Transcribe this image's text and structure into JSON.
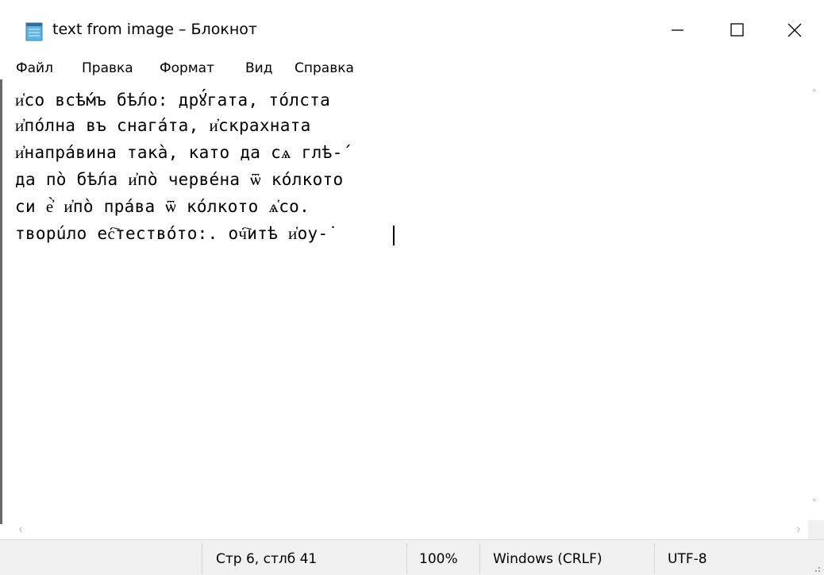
{
  "window": {
    "title": "text from image – Блокнот",
    "app_icon": "notepad-icon"
  },
  "title_buttons": {
    "minimize_icon": "minimize-icon",
    "maximize_icon": "maximize-icon",
    "close_icon": "close-icon"
  },
  "menu": {
    "items": [
      "Файл",
      "Правка",
      "Формат",
      "Вид",
      "Справка"
    ]
  },
  "editor": {
    "lines": [
      "и҅со всѣ́мъ бѣ́ло: дрꙋ́гата, то́лста",
      "и҆по́лна въ снага́та, и҆скрахната",
      "и҆напра́вина такà, като да сѧ глѣ-́",
      "да пò бѣ́ла и҆пò черве́на ѿ ко́лкото",
      "си е҆̀ и҆пò пра́ва ѿ ко́лкото ѧ҅со.",
      "творúло ес҇тество́то:. оч҇итѣ и҅оу-̇"
    ]
  },
  "status": {
    "position": "Стр 6, стлб 41",
    "zoom": "100%",
    "line_endings": "Windows (CRLF)",
    "encoding": "UTF-8"
  },
  "colors": {
    "background": "#ffffff",
    "statusbar": "#f0f0f0",
    "scroll_arrow": "#b8b8b8"
  }
}
